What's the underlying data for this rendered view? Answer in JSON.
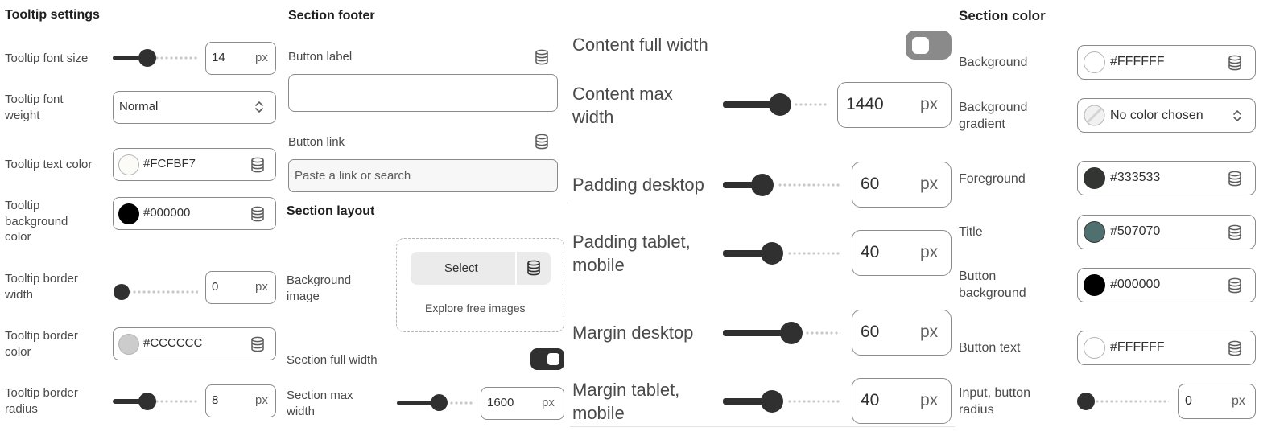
{
  "tooltip": {
    "heading": "Tooltip settings",
    "font_size_label": "Tooltip font size",
    "font_size_value": "14",
    "font_size_unit": "px",
    "font_weight_label": "Tooltip font weight",
    "font_weight_value": "Normal",
    "text_color_label": "Tooltip text color",
    "text_color_value": "#FCFBF7",
    "bg_color_label": "Tooltip background color",
    "bg_color_value": "#000000",
    "border_width_label": "Tooltip border width",
    "border_width_value": "0",
    "border_width_unit": "px",
    "border_color_label": "Tooltip border color",
    "border_color_value": "#CCCCCC",
    "border_radius_label": "Tooltip border radius",
    "border_radius_value": "8",
    "border_radius_unit": "px"
  },
  "footer": {
    "heading": "Section footer",
    "button_label_label": "Button label",
    "button_label_value": "",
    "button_link_label": "Button link",
    "button_link_placeholder": "Paste a link or search"
  },
  "layout": {
    "heading": "Section layout",
    "bg_image_label": "Background image",
    "select_button": "Select",
    "explore_link": "Explore free images",
    "full_width_label": "Section full width",
    "full_width_on": true,
    "max_width_label": "Section max width",
    "max_width_value": "1600",
    "max_width_unit": "px"
  },
  "content": {
    "full_width_label": "Content full width",
    "full_width_on": false,
    "max_width_label": "Content max width",
    "max_width_value": "1440",
    "max_width_unit": "px",
    "padding_desktop_label": "Padding desktop",
    "padding_desktop_value": "60",
    "padding_desktop_unit": "px",
    "padding_tablet_label": "Padding tablet, mobile",
    "padding_tablet_value": "40",
    "padding_tablet_unit": "px",
    "margin_desktop_label": "Margin desktop",
    "margin_desktop_value": "60",
    "margin_desktop_unit": "px",
    "margin_tablet_label": "Margin tablet, mobile",
    "margin_tablet_value": "40",
    "margin_tablet_unit": "px"
  },
  "colors": {
    "heading": "Section color",
    "background_label": "Background",
    "background_value": "#FFFFFF",
    "gradient_label": "Background gradient",
    "gradient_value": "No color chosen",
    "foreground_label": "Foreground",
    "foreground_value": "#333533",
    "title_label": "Title",
    "title_value": "#507070",
    "button_bg_label": "Button background",
    "button_bg_value": "#000000",
    "button_text_label": "Button text",
    "button_text_value": "#FFFFFF",
    "radius_label": "Input, button radius",
    "radius_value": "0",
    "radius_unit": "px"
  },
  "icons": {
    "database": "database-icon",
    "chevron": "chevron-up-down-icon",
    "no_color": "no-color-icon"
  },
  "palette": {
    "text_primary": "#303030",
    "border": "#8a8a8a",
    "toggle_on": "#303030",
    "toggle_off": "#8a8a8a"
  }
}
